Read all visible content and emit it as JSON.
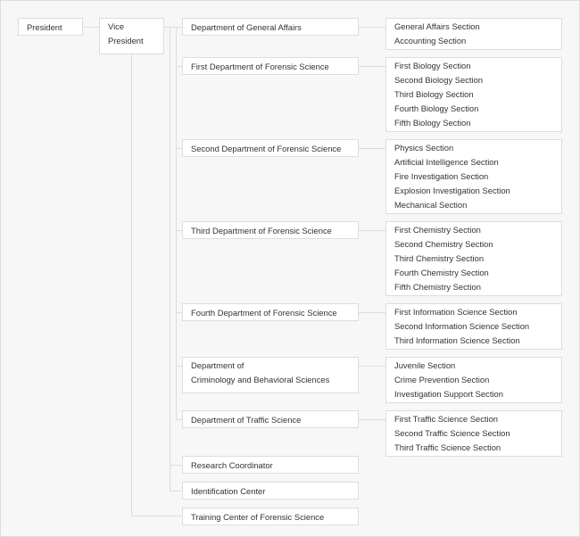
{
  "president": "President",
  "vice_president": [
    "Vice",
    "President"
  ],
  "departments": [
    {
      "name": [
        "Department of General Affairs"
      ],
      "sections": [
        "General Affairs Section",
        "Accounting Section"
      ]
    },
    {
      "name": [
        "First Department of Forensic Science"
      ],
      "sections": [
        "First Biology Section",
        "Second Biology Section",
        "Third Biology Section",
        "Fourth Biology Section",
        "Fifth Biology Section"
      ]
    },
    {
      "name": [
        "Second Department of Forensic Science"
      ],
      "sections": [
        "Physics Section",
        "Artificial Intelligence Section",
        "Fire Investigation Section",
        "Explosion Investigation Section",
        "Mechanical Section"
      ]
    },
    {
      "name": [
        "Third Department of Forensic Science"
      ],
      "sections": [
        "First Chemistry Section",
        "Second Chemistry Section",
        "Third Chemistry Section",
        "Fourth Chemistry Section",
        "Fifth Chemistry Section"
      ]
    },
    {
      "name": [
        "Fourth Department of Forensic Science"
      ],
      "sections": [
        "First Information Science Section",
        "Second Information Science Section",
        "Third Information Science Section"
      ]
    },
    {
      "name": [
        "Department of",
        "Criminology and Behavioral Sciences"
      ],
      "sections": [
        "Juvenile Section",
        "Crime Prevention Section",
        "Investigation Support Section"
      ]
    },
    {
      "name": [
        "Department of Traffic Science"
      ],
      "sections": [
        "First Traffic Science Section",
        "Second Traffic Science Section",
        "Third Traffic Science Section"
      ]
    }
  ],
  "other_units": [
    "Research Coordinator",
    "Identification Center"
  ],
  "training_center": "Training Center of Forensic Science",
  "colors": {
    "background": "#f7f7f7",
    "box": "#ffffff",
    "border": "#dddddd",
    "text": "#333333"
  }
}
